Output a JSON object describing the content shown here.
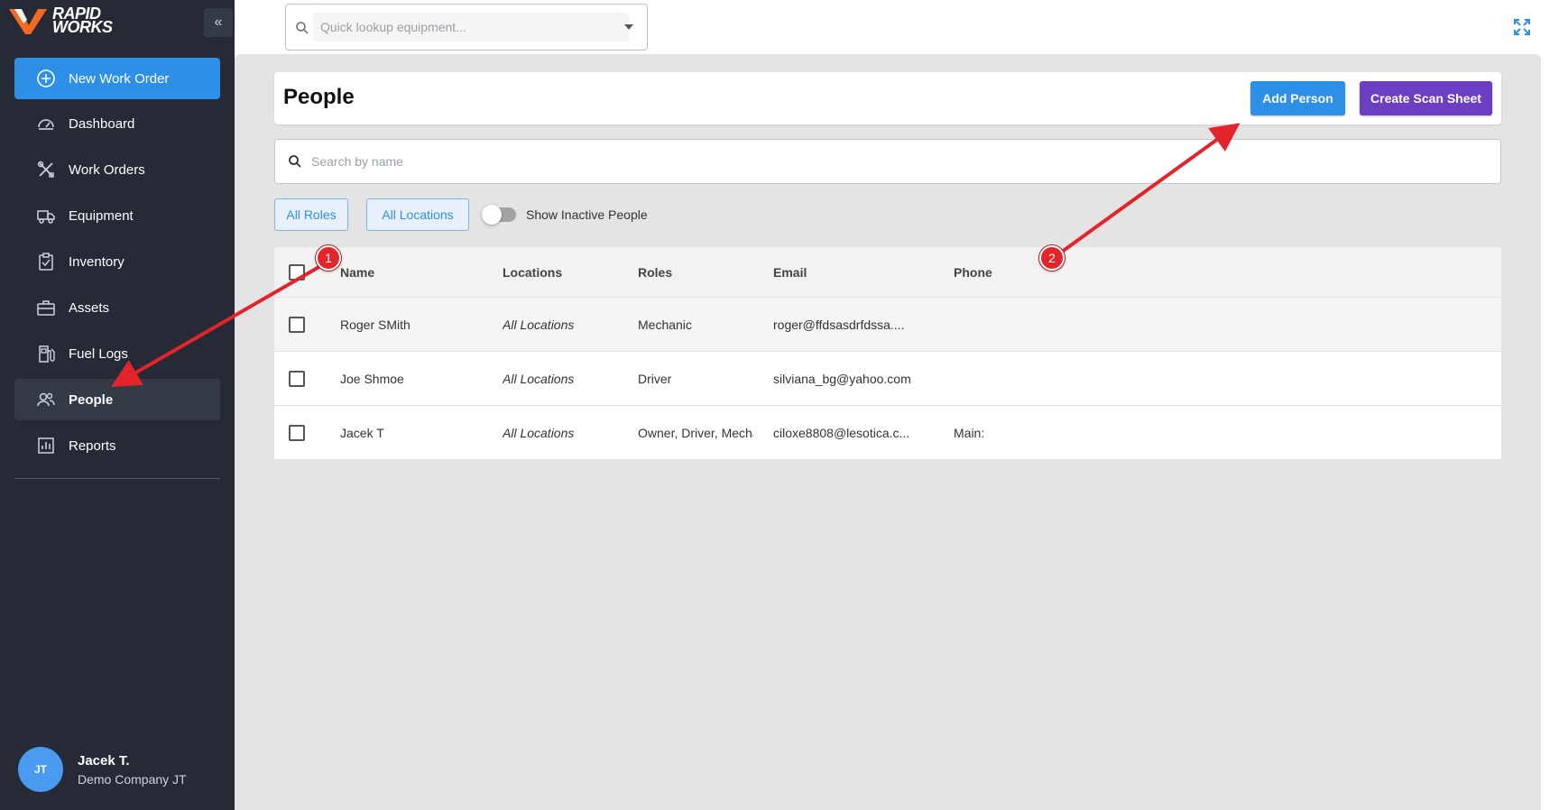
{
  "brand": {
    "line1": "RAPID",
    "line2": "WORKS"
  },
  "sidebar": {
    "collapse_label": "«",
    "new_work_order": "New Work Order",
    "items": [
      {
        "label": "Dashboard",
        "icon": "gauge-icon"
      },
      {
        "label": "Work Orders",
        "icon": "tools-icon"
      },
      {
        "label": "Equipment",
        "icon": "truck-icon"
      },
      {
        "label": "Inventory",
        "icon": "clipboard-check-icon"
      },
      {
        "label": "Assets",
        "icon": "briefcase-icon"
      },
      {
        "label": "Fuel Logs",
        "icon": "fuel-pump-icon"
      },
      {
        "label": "People",
        "icon": "people-icon",
        "active": true
      },
      {
        "label": "Reports",
        "icon": "bar-chart-icon"
      }
    ]
  },
  "user": {
    "initials": "JT",
    "name": "Jacek T.",
    "company": "Demo Company JT"
  },
  "topbar": {
    "lookup_placeholder": "Quick lookup equipment..."
  },
  "page": {
    "title": "People",
    "add_person": "Add Person",
    "create_scan_sheet": "Create Scan Sheet",
    "search_placeholder": "Search by name",
    "filters": {
      "roles": "All Roles",
      "locations": "All Locations"
    },
    "show_inactive": "Show Inactive People"
  },
  "table": {
    "columns": [
      "Name",
      "Locations",
      "Roles",
      "Email",
      "Phone"
    ],
    "rows": [
      {
        "name": "Roger SMith",
        "locations": "All Locations",
        "roles": "Mechanic",
        "email": "roger@ffdsasdrfdssa....",
        "phone": ""
      },
      {
        "name": "Joe Shmoe",
        "locations": "All Locations",
        "roles": "Driver",
        "email": "silviana_bg@yahoo.com",
        "phone": ""
      },
      {
        "name": "Jacek T",
        "locations": "All Locations",
        "roles": "Owner, Driver, Mecha",
        "email": "ciloxe8808@lesotica.c...",
        "phone": "Main:"
      }
    ]
  },
  "annotations": {
    "step1": "1",
    "step2": "2",
    "color": "#e3242b"
  },
  "colors": {
    "sidebar": "#262a37",
    "primary": "#2d8fe6",
    "purple": "#6c3ec2"
  }
}
